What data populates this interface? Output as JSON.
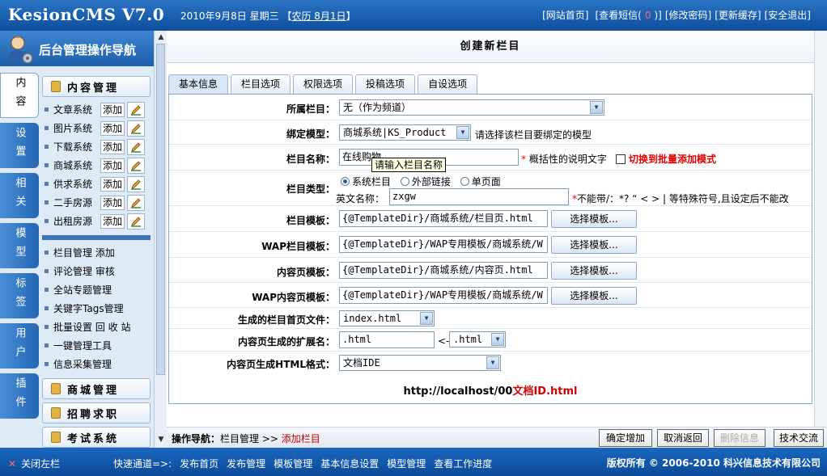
{
  "header": {
    "logo": "KesionCMS V7.0",
    "date": "2010年9月8日 星期三",
    "lunar_open": "【",
    "lunar": "农历 8月1日",
    "lunar_close": "】",
    "links": [
      "[网站首页]",
      "[查看短信(",
      "0",
      ")]",
      "[修改密码]",
      "[更新缓存]",
      "[安全退出]"
    ]
  },
  "nav": {
    "title": "后台管理操作导航",
    "vtabs": [
      "内容",
      "设置",
      "相关",
      "模型",
      "标签",
      "用户",
      "插件"
    ],
    "content_group": "内容管理",
    "items": [
      "文章系统",
      "图片系统",
      "下载系统",
      "商城系统",
      "供求系统",
      "二手房源",
      "出租房源"
    ],
    "add_label": "添加",
    "links": [
      "栏目管理 添加",
      "评论管理 审核",
      "全站专题管理",
      "关键字Tags管理",
      "批量设置 回 收 站",
      "一键管理工具",
      "信息采集管理"
    ],
    "groups": [
      "商城管理",
      "招聘求职",
      "考试系统"
    ]
  },
  "page": {
    "title": "创建新栏目",
    "tabs": [
      "基本信息",
      "栏目选项",
      "权限选项",
      "投稿选项",
      "自设选项"
    ]
  },
  "form": {
    "parent_label": "所属栏目：",
    "parent_value": "无（作为频道）",
    "model_label": "绑定模型：",
    "model_value": "商城系统|KS_Product",
    "model_hint": "请选择该栏目要绑定的模型",
    "name_label": "栏目名称：",
    "name_value": "在线购物",
    "name_hint": "概括性的说明文字",
    "batch_label": "切换到批量添加模式",
    "tooltip": "请输入栏目名称",
    "type_label": "栏目类型：",
    "type_options": [
      "系统栏目",
      "外部链接",
      "单页面"
    ],
    "ename_label": "英文名称：",
    "ename_value": "zxgw",
    "ename_hint": "不能带/：*? “ < > | 等特殊符号,且设定后不能改",
    "tpl_label": "栏目模板：",
    "tpl_value": "{@TemplateDir}/商城系统/栏目页.html",
    "wap_tpl_label": "WAP栏目模板：",
    "wap_tpl_value": "{@TemplateDir}/WAP专用模板/商城系统/W",
    "content_tpl_label": "内容页模板：",
    "content_tpl_value": "{@TemplateDir}/商城系统/内容页.html",
    "wap_content_tpl_label": "WAP内容页模板：",
    "wap_content_tpl_value": "{@TemplateDir}/WAP专用模板/商城系统/W",
    "choose_tpl": "选择模板...",
    "index_file_label": "生成的栏目首页文件：",
    "index_file_value": "index.html",
    "ext_label": "内容页生成的扩展名：",
    "ext_value": ".html",
    "ext_arrow": "<-",
    "ext_select": ".html",
    "html_fmt_label": "内容页生成HTML格式：",
    "html_fmt_value": "文档IDE",
    "url_prefix": "http://localhost/00",
    "url_suffix": "文档ID.html"
  },
  "bottom": {
    "crumb_label": "操作导航：",
    "crumb_item": "栏目管理",
    "crumb_sep": ">>",
    "crumb_current": "添加栏目",
    "buttons": [
      "确定增加",
      "取消返回",
      "删除信息",
      "技术交流"
    ]
  },
  "footer": {
    "close": "关闭左栏",
    "quick_label": "快速通道=>:",
    "quick_links": [
      "发布首页",
      "发布管理",
      "模板管理",
      "基本信息设置",
      "模型管理",
      "查看工作进度"
    ],
    "copyright": "版权所有 © 2006-2010 科兴信息技术有限公司"
  },
  "colors": {
    "brand_blue": "#0d4f9e",
    "required_red": "#e00000",
    "link_red": "#d40000"
  }
}
